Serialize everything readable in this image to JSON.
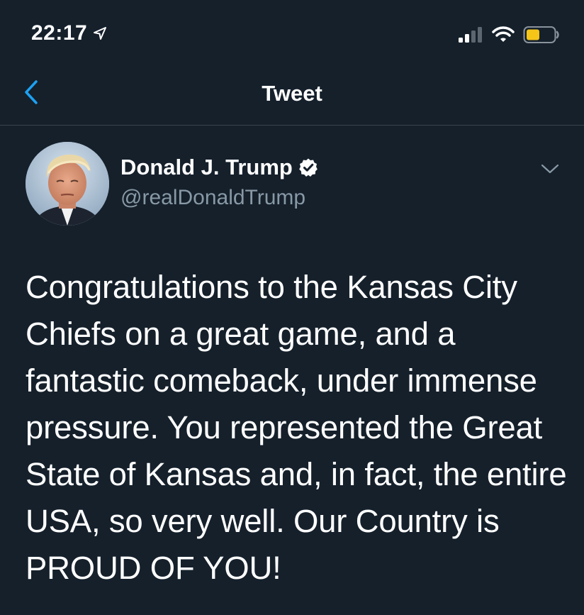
{
  "status_bar": {
    "time": "22:17",
    "location_icon": "location-arrow-icon",
    "signal_icon": "cellular-signal-icon",
    "wifi_icon": "wifi-icon",
    "battery_icon": "battery-low-icon",
    "battery_color": "#f5c518"
  },
  "nav": {
    "back_icon": "chevron-left-icon",
    "title": "Tweet",
    "accent_color": "#1da1f2"
  },
  "tweet": {
    "author": {
      "display_name": "Donald J. Trump",
      "verified": true,
      "verified_icon": "verified-badge-icon",
      "handle": "@realDonaldTrump",
      "avatar": "profile-photo"
    },
    "more_icon": "chevron-down-icon",
    "text": "Congratulations to the Kansas City Chiefs on a great game, and a fantastic comeback, under immense pressure. You represented the Great State of Kansas and, in fact, the entire USA, so very well. Our Country is PROUD OF YOU!"
  }
}
